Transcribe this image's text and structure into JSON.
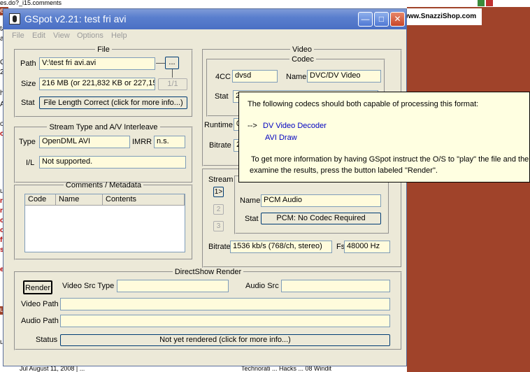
{
  "background": {
    "address_fragment": "es.do?_i15.comments",
    "left_snippets": [
      "es",
      "ta",
      "ay",
      "C",
      "21",
      "he",
      "A",
      "o",
      "od",
      "uid",
      "rov",
      "rov",
      "ow",
      "ow",
      "fy",
      "sit",
      "ew",
      "us",
      "u"
    ],
    "red_snippets": [
      "od",
      "rov",
      "rov",
      "ow",
      "ow",
      "fy",
      "sit",
      "ew"
    ],
    "banner_text": "www.SnazziShop.com",
    "bottom_left_text": "Jul August 11, 2008 | ...",
    "bottom_right_text": "Technorati ... Hacks ... 08 Windit"
  },
  "window": {
    "title": "GSpot v2.21: test fri avi",
    "menu": [
      "File",
      "Edit",
      "View",
      "Options",
      "Help"
    ]
  },
  "file": {
    "legend": "File",
    "path_label": "Path",
    "path_value": "V:\\test fri avi.avi",
    "browse_label": "...",
    "size_label": "Size",
    "size_value": "216 MB (or 221,832 KB or 227,15",
    "part_label": "1/1",
    "stat_label": "Stat",
    "stat_button": "File Length Correct (click for more info...)"
  },
  "stream_type": {
    "legend": "Stream Type and A/V Interleave",
    "type_label": "Type",
    "type_value": "OpenDML AVI",
    "imrr_label": "IMRR",
    "imrr_value": "n.s.",
    "il_label": "I/L",
    "il_value": "Not supported."
  },
  "comments": {
    "legend": "Comments / Metadata",
    "columns": [
      "Code",
      "Name",
      "Contents"
    ]
  },
  "video": {
    "legend": "Video",
    "codec_legend": "Codec",
    "fourcc_label": "4CC",
    "fourcc_value": "dvsd",
    "name_label": "Name",
    "name_value": "DVC/DV Video",
    "stat_label": "Stat",
    "stat_value": "2",
    "runtime_label": "Runtime",
    "runtime_value": "0",
    "bitrate_label": "Bitrate",
    "bitrate_value": "2"
  },
  "tooltip": {
    "line1": "The following codecs should both capable of processing this format:",
    "arrow": "-->",
    "codec1": "DV Video Decoder",
    "codec2": "AVI Draw",
    "line2": "To get more information by having GSpot instruct the O/S to \"play\" the file and then",
    "line3": "examine the results,  press the button labeled \"Render\"."
  },
  "audio": {
    "stream_label": "Stream",
    "stream_buttons": [
      "1>",
      "2",
      "3"
    ],
    "name_label": "Name",
    "name_value": "PCM Audio",
    "stat_label": "Stat",
    "stat_value": "PCM: No Codec Required",
    "bitrate_label": "Bitrate",
    "bitrate_value": "1536 kb/s (768/ch, stereo)",
    "fs_label": "Fs",
    "fs_value": "48000 Hz"
  },
  "directshow": {
    "legend": "DirectShow Render",
    "render_button": "Render",
    "video_src_label": "Video Src Type",
    "audio_src_label": "Audio Src",
    "video_path_label": "Video Path",
    "audio_path_label": "Audio Path",
    "status_label": "Status",
    "status_button": "Not yet rendered (click for more info...)"
  },
  "colors": {
    "brown_bg": "#a0432a",
    "field_bg": "#fffbdc",
    "tooltip_bg": "#ffffe1",
    "window_bg": "#ece9d8",
    "title_blue": "#4a6fc4",
    "link_blue": "#0000c0"
  }
}
